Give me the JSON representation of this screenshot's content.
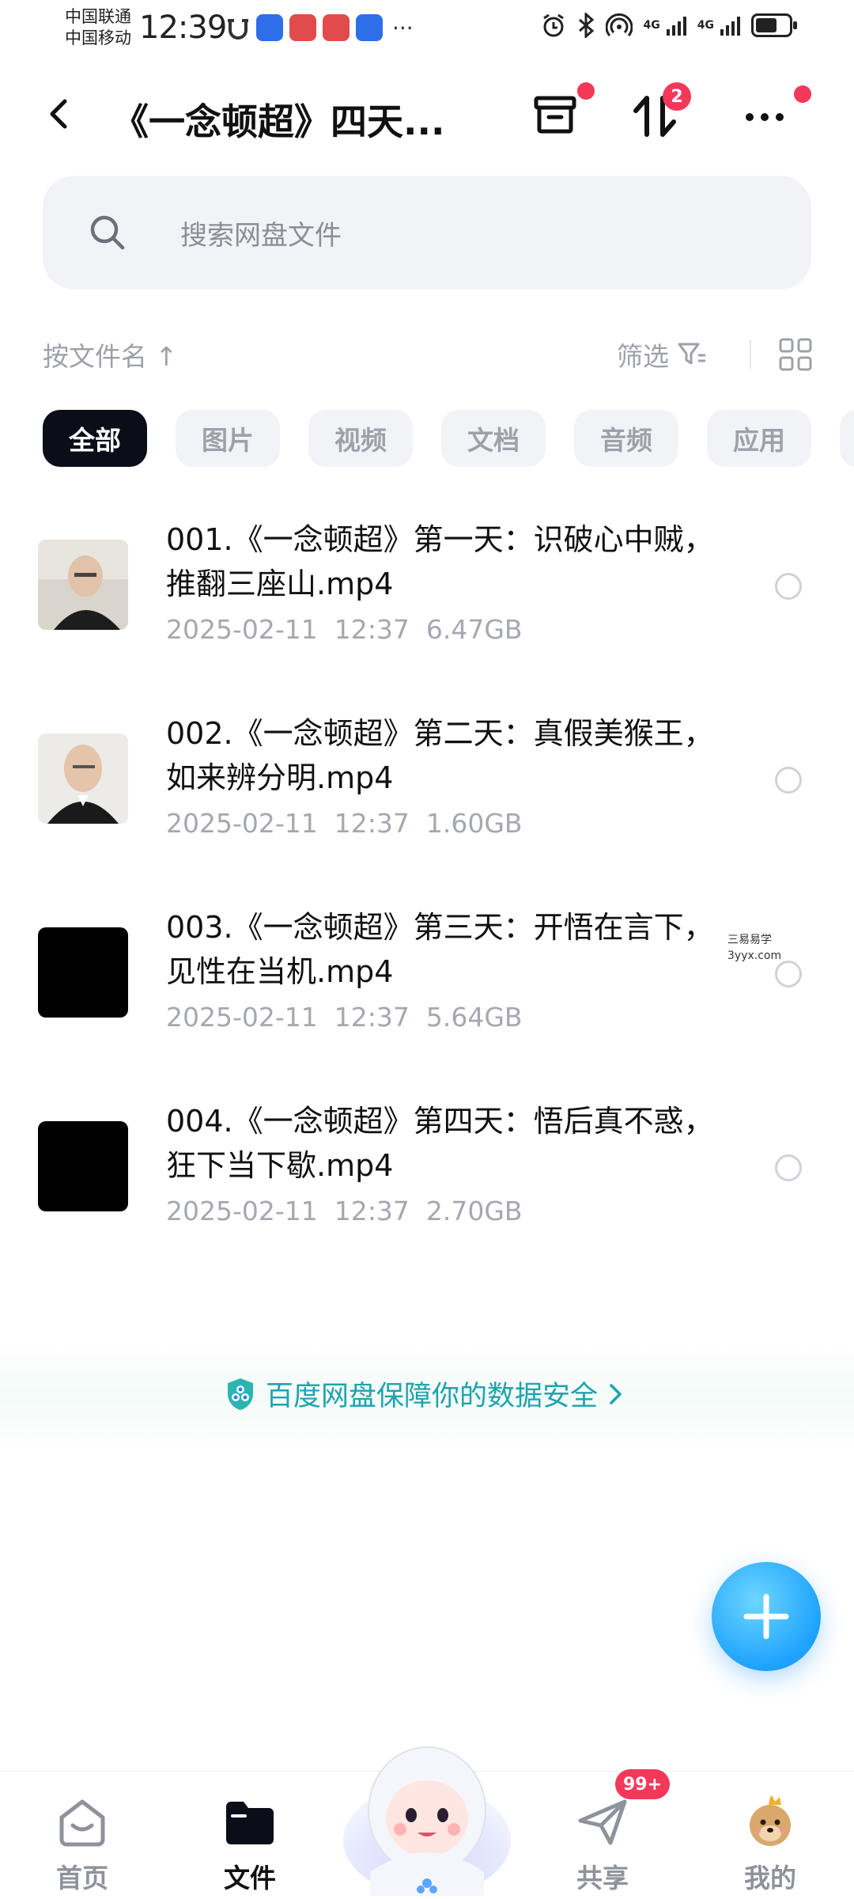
{
  "status_bar": {
    "carrier_1": "中国联通",
    "carrier_2": "中国移动",
    "time": "12:39",
    "more": "···",
    "network_1": "4G",
    "network_2": "4G"
  },
  "header": {
    "title": "《一念顿超》四天...",
    "transfer_badge": "2"
  },
  "search": {
    "placeholder": "搜索网盘文件"
  },
  "sort": {
    "label": "按文件名 ↑",
    "filter_label": "筛选"
  },
  "tabs": [
    {
      "label": "全部",
      "active": true
    },
    {
      "label": "图片",
      "active": false
    },
    {
      "label": "视频",
      "active": false
    },
    {
      "label": "文档",
      "active": false
    },
    {
      "label": "音频",
      "active": false
    },
    {
      "label": "应用",
      "active": false
    }
  ],
  "files": [
    {
      "name": "001.《一念顿超》第一天：识破心中贼，推翻三座山.mp4",
      "date": "2025-02-11",
      "time": "12:37",
      "size": "6.47GB",
      "thumb": "person-photo"
    },
    {
      "name": "002.《一念顿超》第二天：真假美猴王，如来辨分明.mp4",
      "date": "2025-02-11",
      "time": "12:37",
      "size": "1.60GB",
      "thumb": "person-photo"
    },
    {
      "name": "003.《一念顿超》第三天：开悟在言下，见性在当机.mp4",
      "date": "2025-02-11",
      "time": "12:37",
      "size": "5.64GB",
      "thumb": "black"
    },
    {
      "name": "004.《一念顿超》第四天：悟后真不惑，狂下当下歇.mp4",
      "date": "2025-02-11",
      "time": "12:37",
      "size": "2.70GB",
      "thumb": "black"
    }
  ],
  "watermark": {
    "line1": "三易易学",
    "line2": "3yyx.com"
  },
  "safety_banner": {
    "text": "百度网盘保障你的数据安全"
  },
  "bottom_nav": {
    "home": "首页",
    "files": "文件",
    "share": "共享",
    "share_badge": "99+",
    "mine": "我的"
  },
  "colors": {
    "accent": "#1ea2ff",
    "active_tab": "#0b0e19",
    "badge_red": "#f4385a",
    "safety_teal": "#1fa3ad"
  }
}
